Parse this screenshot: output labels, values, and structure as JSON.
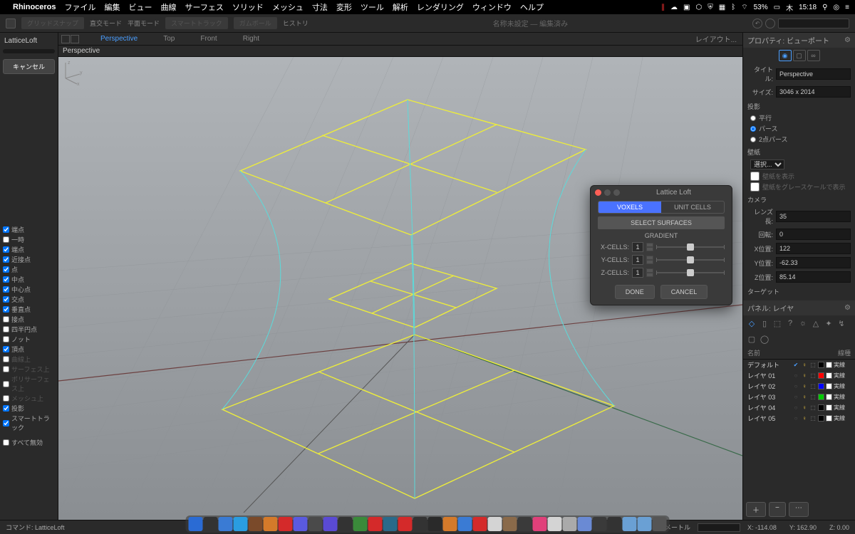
{
  "menubar": {
    "app": "Rhinoceros",
    "items": [
      "ファイル",
      "編集",
      "ビュー",
      "曲線",
      "サーフェス",
      "ソリッド",
      "メッシュ",
      "寸法",
      "変形",
      "ツール",
      "解析",
      "レンダリング",
      "ウィンドウ",
      "ヘルプ"
    ],
    "battery": "53%",
    "day": "木",
    "time": "15:18"
  },
  "toolbar": {
    "modes": [
      "グリッドスナップ",
      "直交モード",
      "平面モード",
      "スマートトラック",
      "ガムボール",
      "ヒストリ"
    ],
    "title": "名称未設定 — 編集済み"
  },
  "left": {
    "command": "LatticeLoft",
    "cancel": "キャンセル",
    "snaps": [
      {
        "label": "端点",
        "on": true
      },
      {
        "label": "一時",
        "on": false
      },
      {
        "label": "端点",
        "on": true
      },
      {
        "label": "近接点",
        "on": true
      },
      {
        "label": "点",
        "on": true
      },
      {
        "label": "中点",
        "on": true
      },
      {
        "label": "中心点",
        "on": true
      },
      {
        "label": "交点",
        "on": true
      },
      {
        "label": "垂直点",
        "on": true
      },
      {
        "label": "接点",
        "on": false
      },
      {
        "label": "四半円点",
        "on": false
      },
      {
        "label": "ノット",
        "on": false
      },
      {
        "label": "頂点",
        "on": true
      },
      {
        "label": "曲線上",
        "on": false,
        "dim": true
      },
      {
        "label": "サーフェス上",
        "on": false,
        "dim": true
      },
      {
        "label": "ポリサーフェス上",
        "on": false,
        "dim": true
      },
      {
        "label": "メッシュ上",
        "on": false,
        "dim": true
      },
      {
        "label": "投影",
        "on": true
      },
      {
        "label": "スマートトラック",
        "on": true
      }
    ],
    "disable_all": "すべて無効"
  },
  "viewtabs": {
    "tabs": [
      "Perspective",
      "Top",
      "Front",
      "Right"
    ],
    "active": 0,
    "layout": "レイアウト...",
    "vp_label": "Perspective"
  },
  "right": {
    "properties_hdr": "プロパティ: ビューポート",
    "title_lbl": "タイトル:",
    "title_val": "Perspective",
    "size_lbl": "サイズ:",
    "size_val": "3046 x 2014",
    "projection": "投影",
    "proj_items": [
      "平行",
      "パース",
      "2点パース"
    ],
    "proj_sel": 1,
    "wallpaper": "壁紙",
    "wp_select": "選択...",
    "wp_show": "壁紙を表示",
    "wp_gray": "壁紙をグレースケールで表示",
    "camera": "カメラ",
    "cam": [
      {
        "lbl": "レンズ長:",
        "val": "35"
      },
      {
        "lbl": "回転:",
        "val": "0"
      },
      {
        "lbl": "X位置:",
        "val": "122"
      },
      {
        "lbl": "Y位置:",
        "val": "-62.33"
      },
      {
        "lbl": "Z位置:",
        "val": "85.14"
      }
    ],
    "target": "ターゲット",
    "panel_hdr": "パネル: レイヤ",
    "layers_hdr": {
      "name": "名前",
      "linetype": "線種"
    },
    "layers": [
      {
        "name": "デフォルト",
        "cur": true,
        "c1": "#000",
        "c2": "#fff",
        "lt": "実線"
      },
      {
        "name": "レイヤ 01",
        "cur": false,
        "c1": "#f00",
        "c2": "#fff",
        "lt": "実線"
      },
      {
        "name": "レイヤ 02",
        "cur": false,
        "c1": "#00f",
        "c2": "#fff",
        "lt": "実線"
      },
      {
        "name": "レイヤ 03",
        "cur": false,
        "c1": "#0c0",
        "c2": "#fff",
        "lt": "実線"
      },
      {
        "name": "レイヤ 04",
        "cur": false,
        "c1": "#000",
        "c2": "#fff",
        "lt": "実線"
      },
      {
        "name": "レイヤ 05",
        "cur": false,
        "c1": "#000",
        "c2": "#fff",
        "lt": "実線"
      }
    ]
  },
  "dialog": {
    "title": "Lattice Loft",
    "tab_voxels": "VOXELS",
    "tab_unit": "UNIT CELLS",
    "select_surfaces": "SELECT SURFACES",
    "gradient": "GRADIENT",
    "xcells_lbl": "X-CELLS:",
    "xcells": "1",
    "ycells_lbl": "Y-CELLS:",
    "ycells": "1",
    "zcells_lbl": "Z-CELLS:",
    "zcells": "1",
    "done": "DONE",
    "cancel": "CANCEL"
  },
  "status": {
    "command_lbl": "コマンド:",
    "command": "LatticeLoft",
    "unit": "ミリメートル",
    "x_lbl": "X:",
    "x": "-114.08",
    "y_lbl": "Y:",
    "y": "162.90",
    "z_lbl": "Z:",
    "z": "0.00"
  },
  "dock_colors": [
    "#2a6bd4",
    "#333",
    "#3a7bd4",
    "#2a9de0",
    "#7a4a2a",
    "#d47a2a",
    "#d42a2a",
    "#5a5ae0",
    "#4a4a4a",
    "#5a4ad4",
    "#333",
    "#3a8a3a",
    "#d42a2a",
    "#2a6a8a",
    "#d42a2a",
    "#333",
    "#2a2a2a",
    "#d47a2a",
    "#3a7bd4",
    "#d42a2a",
    "#d4d4d4",
    "#8a6a4a",
    "#3a3a3a",
    "#e0407a",
    "#d4d4d4",
    "#aaa",
    "#6a8ad4",
    "#3a3a3a",
    "#333",
    "#6aa0d4",
    "#6aa0d4",
    "#555"
  ]
}
